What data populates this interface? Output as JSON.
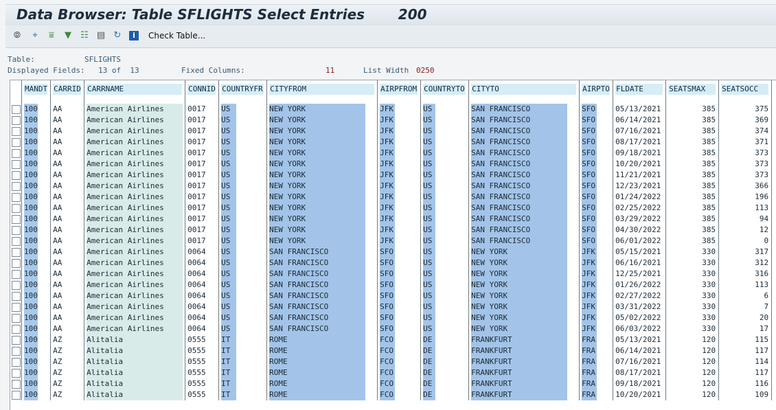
{
  "title": "Data Browser: Table SFLIGHTS Select Entries",
  "entry_count": "200",
  "toolbar": {
    "icons": [
      "glasses-icon",
      "detail-icon",
      "sort-ascending-icon",
      "filter-icon",
      "export-icon",
      "select-columns-icon",
      "refresh-icon",
      "info-icon"
    ],
    "check_table_label": "Check Table..."
  },
  "info": {
    "table_label": "Table:",
    "table_value": "SFLIGHTS",
    "displayed_label": "Displayed Fields:",
    "displayed_value": "13 of  13",
    "fixed_label": "Fixed Columns:",
    "fixed_value": "11",
    "width_label": "List Width",
    "width_value": "0250"
  },
  "columns": [
    "MANDT",
    "CARRID",
    "CARRNAME",
    "CONNID",
    "COUNTRYFR",
    "CITYFROM",
    "AIRPFROM",
    "COUNTRYTO",
    "CITYTO",
    "AIRPTO",
    "FLDATE",
    "SEATSMAX",
    "SEATSOCC"
  ],
  "rows": [
    [
      "100",
      "AA",
      "American Airlines",
      "0017",
      "US",
      "NEW YORK",
      "JFK",
      "US",
      "SAN FRANCISCO",
      "SFO",
      "05/13/2021",
      "385",
      "375"
    ],
    [
      "100",
      "AA",
      "American Airlines",
      "0017",
      "US",
      "NEW YORK",
      "JFK",
      "US",
      "SAN FRANCISCO",
      "SFO",
      "06/14/2021",
      "385",
      "369"
    ],
    [
      "100",
      "AA",
      "American Airlines",
      "0017",
      "US",
      "NEW YORK",
      "JFK",
      "US",
      "SAN FRANCISCO",
      "SFO",
      "07/16/2021",
      "385",
      "374"
    ],
    [
      "100",
      "AA",
      "American Airlines",
      "0017",
      "US",
      "NEW YORK",
      "JFK",
      "US",
      "SAN FRANCISCO",
      "SFO",
      "08/17/2021",
      "385",
      "371"
    ],
    [
      "100",
      "AA",
      "American Airlines",
      "0017",
      "US",
      "NEW YORK",
      "JFK",
      "US",
      "SAN FRANCISCO",
      "SFO",
      "09/18/2021",
      "385",
      "373"
    ],
    [
      "100",
      "AA",
      "American Airlines",
      "0017",
      "US",
      "NEW YORK",
      "JFK",
      "US",
      "SAN FRANCISCO",
      "SFO",
      "10/20/2021",
      "385",
      "373"
    ],
    [
      "100",
      "AA",
      "American Airlines",
      "0017",
      "US",
      "NEW YORK",
      "JFK",
      "US",
      "SAN FRANCISCO",
      "SFO",
      "11/21/2021",
      "385",
      "373"
    ],
    [
      "100",
      "AA",
      "American Airlines",
      "0017",
      "US",
      "NEW YORK",
      "JFK",
      "US",
      "SAN FRANCISCO",
      "SFO",
      "12/23/2021",
      "385",
      "366"
    ],
    [
      "100",
      "AA",
      "American Airlines",
      "0017",
      "US",
      "NEW YORK",
      "JFK",
      "US",
      "SAN FRANCISCO",
      "SFO",
      "01/24/2022",
      "385",
      "196"
    ],
    [
      "100",
      "AA",
      "American Airlines",
      "0017",
      "US",
      "NEW YORK",
      "JFK",
      "US",
      "SAN FRANCISCO",
      "SFO",
      "02/25/2022",
      "385",
      "113"
    ],
    [
      "100",
      "AA",
      "American Airlines",
      "0017",
      "US",
      "NEW YORK",
      "JFK",
      "US",
      "SAN FRANCISCO",
      "SFO",
      "03/29/2022",
      "385",
      "94"
    ],
    [
      "100",
      "AA",
      "American Airlines",
      "0017",
      "US",
      "NEW YORK",
      "JFK",
      "US",
      "SAN FRANCISCO",
      "SFO",
      "04/30/2022",
      "385",
      "12"
    ],
    [
      "100",
      "AA",
      "American Airlines",
      "0017",
      "US",
      "NEW YORK",
      "JFK",
      "US",
      "SAN FRANCISCO",
      "SFO",
      "06/01/2022",
      "385",
      "0"
    ],
    [
      "100",
      "AA",
      "American Airlines",
      "0064",
      "US",
      "SAN FRANCISCO",
      "SFO",
      "US",
      "NEW YORK",
      "JFK",
      "05/15/2021",
      "330",
      "317"
    ],
    [
      "100",
      "AA",
      "American Airlines",
      "0064",
      "US",
      "SAN FRANCISCO",
      "SFO",
      "US",
      "NEW YORK",
      "JFK",
      "06/16/2021",
      "330",
      "312"
    ],
    [
      "100",
      "AA",
      "American Airlines",
      "0064",
      "US",
      "SAN FRANCISCO",
      "SFO",
      "US",
      "NEW YORK",
      "JFK",
      "12/25/2021",
      "330",
      "316"
    ],
    [
      "100",
      "AA",
      "American Airlines",
      "0064",
      "US",
      "SAN FRANCISCO",
      "SFO",
      "US",
      "NEW YORK",
      "JFK",
      "01/26/2022",
      "330",
      "113"
    ],
    [
      "100",
      "AA",
      "American Airlines",
      "0064",
      "US",
      "SAN FRANCISCO",
      "SFO",
      "US",
      "NEW YORK",
      "JFK",
      "02/27/2022",
      "330",
      "6"
    ],
    [
      "100",
      "AA",
      "American Airlines",
      "0064",
      "US",
      "SAN FRANCISCO",
      "SFO",
      "US",
      "NEW YORK",
      "JFK",
      "03/31/2022",
      "330",
      "7"
    ],
    [
      "100",
      "AA",
      "American Airlines",
      "0064",
      "US",
      "SAN FRANCISCO",
      "SFO",
      "US",
      "NEW YORK",
      "JFK",
      "05/02/2022",
      "330",
      "20"
    ],
    [
      "100",
      "AA",
      "American Airlines",
      "0064",
      "US",
      "SAN FRANCISCO",
      "SFO",
      "US",
      "NEW YORK",
      "JFK",
      "06/03/2022",
      "330",
      "17"
    ],
    [
      "100",
      "AZ",
      "Alitalia",
      "0555",
      "IT",
      "ROME",
      "FCO",
      "DE",
      "FRANKFURT",
      "FRA",
      "05/13/2021",
      "120",
      "115"
    ],
    [
      "100",
      "AZ",
      "Alitalia",
      "0555",
      "IT",
      "ROME",
      "FCO",
      "DE",
      "FRANKFURT",
      "FRA",
      "06/14/2021",
      "120",
      "117"
    ],
    [
      "100",
      "AZ",
      "Alitalia",
      "0555",
      "IT",
      "ROME",
      "FCO",
      "DE",
      "FRANKFURT",
      "FRA",
      "07/16/2021",
      "120",
      "114"
    ],
    [
      "100",
      "AZ",
      "Alitalia",
      "0555",
      "IT",
      "ROME",
      "FCO",
      "DE",
      "FRANKFURT",
      "FRA",
      "08/17/2021",
      "120",
      "117"
    ],
    [
      "100",
      "AZ",
      "Alitalia",
      "0555",
      "IT",
      "ROME",
      "FCO",
      "DE",
      "FRANKFURT",
      "FRA",
      "09/18/2021",
      "120",
      "116"
    ],
    [
      "100",
      "AZ",
      "Alitalia",
      "0555",
      "IT",
      "ROME",
      "FCO",
      "DE",
      "FRANKFURT",
      "FRA",
      "10/20/2021",
      "120",
      "109"
    ]
  ]
}
